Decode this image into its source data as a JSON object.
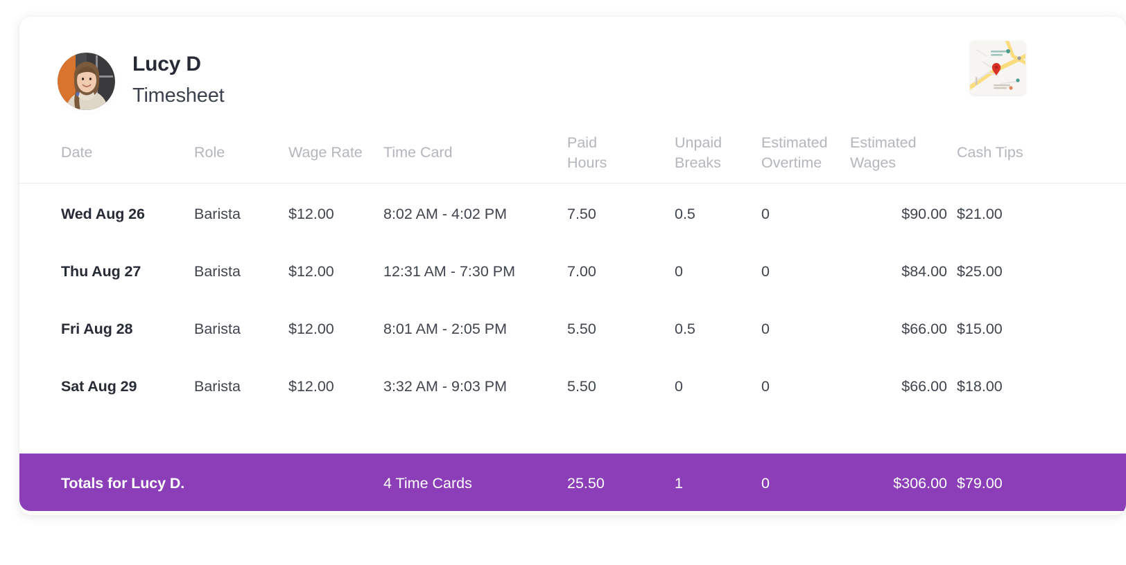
{
  "employee": {
    "name": "Lucy D",
    "subtitle": "Timesheet",
    "avatar_icon": "employee-avatar-photo",
    "map_icon": "location-map-thumbnail"
  },
  "table": {
    "columns": [
      {
        "key": "date",
        "label_lines": [
          "Date"
        ]
      },
      {
        "key": "role",
        "label_lines": [
          "Role"
        ]
      },
      {
        "key": "wage_rate",
        "label_lines": [
          "Wage Rate"
        ]
      },
      {
        "key": "time_card",
        "label_lines": [
          "Time Card"
        ]
      },
      {
        "key": "paid_hours",
        "label_lines": [
          "Paid",
          "Hours"
        ]
      },
      {
        "key": "unpaid_breaks",
        "label_lines": [
          "Unpaid",
          "Breaks"
        ]
      },
      {
        "key": "estimated_overtime",
        "label_lines": [
          "Estimated",
          "Overtime"
        ]
      },
      {
        "key": "estimated_wages",
        "label_lines": [
          "Estimated",
          "Wages"
        ]
      },
      {
        "key": "cash_tips",
        "label_lines": [
          "Cash Tips"
        ]
      }
    ],
    "rows": [
      {
        "date": "Wed Aug 26",
        "role": "Barista",
        "wage_rate": "$12.00",
        "time_card": "8:02 AM - 4:02 PM",
        "paid_hours": "7.50",
        "unpaid_breaks": "0.5",
        "estimated_overtime": "0",
        "estimated_wages": "$90.00",
        "cash_tips": "$21.00"
      },
      {
        "date": "Thu Aug 27",
        "role": "Barista",
        "wage_rate": "$12.00",
        "time_card": "12:31 AM - 7:30 PM",
        "paid_hours": "7.00",
        "unpaid_breaks": "0",
        "estimated_overtime": "0",
        "estimated_wages": "$84.00",
        "cash_tips": "$25.00"
      },
      {
        "date": "Fri Aug 28",
        "role": "Barista",
        "wage_rate": "$12.00",
        "time_card": "8:01 AM - 2:05 PM",
        "paid_hours": "5.50",
        "unpaid_breaks": "0.5",
        "estimated_overtime": "0",
        "estimated_wages": "$66.00",
        "cash_tips": "$15.00"
      },
      {
        "date": "Sat Aug 29",
        "role": "Barista",
        "wage_rate": "$12.00",
        "time_card": "3:32 AM - 9:03 PM",
        "paid_hours": "5.50",
        "unpaid_breaks": "0",
        "estimated_overtime": "0",
        "estimated_wages": "$66.00",
        "cash_tips": "$18.00"
      }
    ],
    "totals": {
      "label": "Totals for Lucy D.",
      "time_card": "4 Time Cards",
      "paid_hours": "25.50",
      "unpaid_breaks": "1",
      "estimated_overtime": "0",
      "estimated_wages": "$306.00",
      "cash_tips": "$79.00"
    }
  },
  "colors": {
    "totals_bar": "#8b3eb8",
    "header_text": "#b3b6bc",
    "body_text": "#3f444e",
    "strong_text": "#262b36",
    "map_pin": "#d93025"
  }
}
